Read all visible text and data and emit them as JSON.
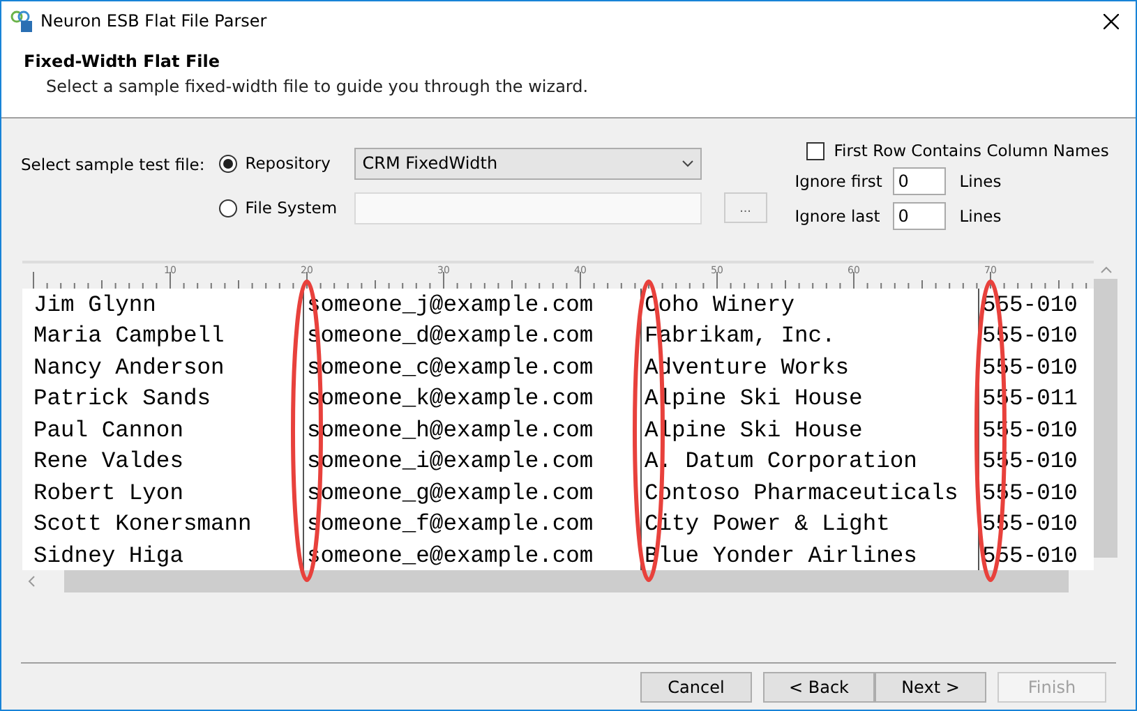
{
  "window": {
    "title": "Neuron ESB Flat File Parser"
  },
  "header": {
    "title": "Fixed-Width Flat File",
    "subtitle": "Select a sample fixed-width file to guide you through the wizard."
  },
  "source": {
    "label": "Select sample test file:",
    "options": [
      {
        "label": "Repository",
        "selected": true,
        "kind": "dropdown",
        "value": "CRM FixedWidth"
      },
      {
        "label": "File System",
        "selected": false,
        "kind": "path",
        "browse": "..."
      }
    ]
  },
  "options": {
    "first_row": {
      "label": "First Row Contains Column Names",
      "checked": false
    },
    "ignore_first": {
      "label": "Ignore first",
      "value": "0",
      "unit": "Lines"
    },
    "ignore_last": {
      "label": "Ignore last",
      "value": "0",
      "unit": "Lines"
    }
  },
  "viewer": {
    "ruler_labels": [
      "10",
      "20",
      "30",
      "40",
      "50",
      "60",
      "70"
    ],
    "rows": [
      [
        "Jim Glynn",
        "someone_j@example.com",
        "Coho Winery",
        "555-010"
      ],
      [
        "Maria Campbell",
        "someone_d@example.com",
        "Fabrikam, Inc.",
        "555-010"
      ],
      [
        "Nancy Anderson",
        "someone_c@example.com",
        "Adventure Works",
        "555-010"
      ],
      [
        "Patrick Sands",
        "someone_k@example.com",
        "Alpine Ski House",
        "555-011"
      ],
      [
        "Paul Cannon",
        "someone_h@example.com",
        "Alpine Ski House",
        "555-010"
      ],
      [
        "Rene Valdes",
        "someone_i@example.com",
        "A. Datum Corporation",
        "555-010"
      ],
      [
        "Robert Lyon",
        "someone_g@example.com",
        "Contoso Pharmaceuticals",
        "555-010"
      ],
      [
        "Scott Konersmann",
        "someone_f@example.com",
        "City Power & Light",
        "555-010"
      ],
      [
        "Sidney Higa",
        "someone_e@example.com",
        "Blue Yonder Airlines",
        "555-010"
      ]
    ]
  },
  "buttons": [
    {
      "label": "Cancel",
      "disabled": false
    },
    {
      "label": "< Back",
      "disabled": false
    },
    {
      "label": "Next >",
      "disabled": false
    },
    {
      "label": "Finish",
      "disabled": true
    }
  ]
}
